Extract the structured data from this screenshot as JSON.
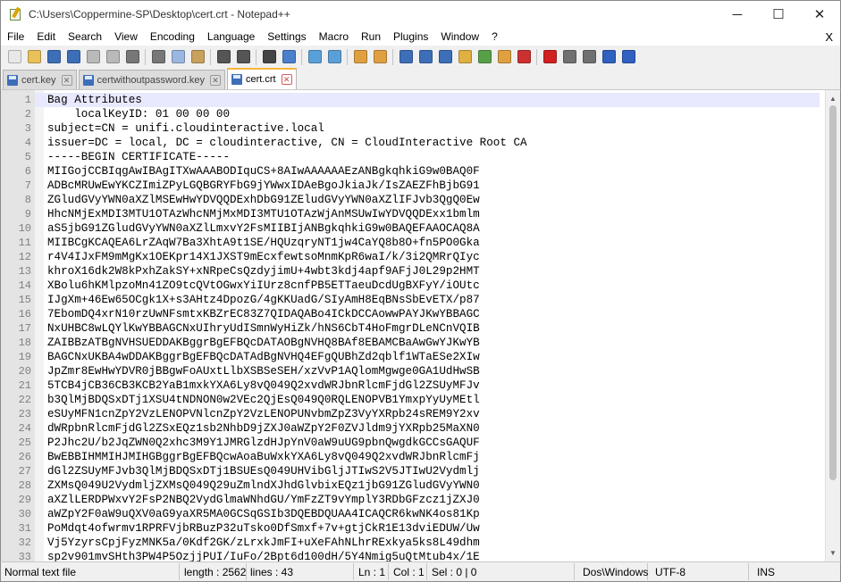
{
  "window": {
    "title": "C:\\Users\\Coppermine-SP\\Desktop\\cert.crt - Notepad++",
    "min": "─",
    "max": "☐",
    "close": "✕"
  },
  "menu": {
    "items": [
      "File",
      "Edit",
      "Search",
      "View",
      "Encoding",
      "Language",
      "Settings",
      "Macro",
      "Run",
      "Plugins",
      "Window",
      "?"
    ],
    "close": "X"
  },
  "toolbar": {
    "buttons": [
      {
        "name": "new-file-icon",
        "color": "#e8e8e8"
      },
      {
        "name": "open-file-icon",
        "color": "#e8c15a"
      },
      {
        "name": "save-icon",
        "color": "#3d6fb8"
      },
      {
        "name": "save-all-icon",
        "color": "#3d6fb8"
      },
      {
        "name": "close-icon",
        "color": "#b9b9b9"
      },
      {
        "name": "close-all-icon",
        "color": "#b9b9b9"
      },
      {
        "name": "print-icon",
        "color": "#777777"
      },
      {
        "sep": true
      },
      {
        "name": "cut-icon",
        "color": "#777777"
      },
      {
        "name": "copy-icon",
        "color": "#9bb7df"
      },
      {
        "name": "paste-icon",
        "color": "#c9a15e"
      },
      {
        "sep": true
      },
      {
        "name": "undo-icon",
        "color": "#555555"
      },
      {
        "name": "redo-icon",
        "color": "#555555"
      },
      {
        "sep": true
      },
      {
        "name": "find-icon",
        "color": "#444444"
      },
      {
        "name": "replace-icon",
        "color": "#4a7fcb"
      },
      {
        "sep": true
      },
      {
        "name": "zoom-in-icon",
        "color": "#5aa0d8"
      },
      {
        "name": "zoom-out-icon",
        "color": "#5aa0d8"
      },
      {
        "sep": true
      },
      {
        "name": "sync-vertical-icon",
        "color": "#e0a040"
      },
      {
        "name": "sync-horizontal-icon",
        "color": "#e0a040"
      },
      {
        "sep": true
      },
      {
        "name": "word-wrap-icon",
        "color": "#3d6fb8"
      },
      {
        "name": "show-all-chars-icon",
        "color": "#3d6fb8"
      },
      {
        "name": "indent-guide-icon",
        "color": "#3d6fb8"
      },
      {
        "name": "user-language-icon",
        "color": "#e0b040"
      },
      {
        "name": "document-map-icon",
        "color": "#58a048"
      },
      {
        "name": "function-list-icon",
        "color": "#e0a040"
      },
      {
        "name": "folder-as-workspace-icon",
        "color": "#cc3030"
      },
      {
        "sep": true
      },
      {
        "name": "record-macro-icon",
        "color": "#d02020"
      },
      {
        "name": "stop-recording-icon",
        "color": "#707070"
      },
      {
        "name": "playback-macro-icon",
        "color": "#707070"
      },
      {
        "name": "run-macro-multiple-icon",
        "color": "#3060c0"
      },
      {
        "name": "save-macro-icon",
        "color": "#3060c0"
      }
    ]
  },
  "tabs": [
    {
      "label": "cert.key",
      "active": false
    },
    {
      "label": "certwithoutpassword.key",
      "active": false
    },
    {
      "label": "cert.crt",
      "active": true
    }
  ],
  "editor": {
    "lines": [
      "Bag Attributes",
      "    localKeyID: 01 00 00 00",
      "subject=CN = unifi.cloudinteractive.local",
      "issuer=DC = local, DC = cloudinteractive, CN = CloudInteractive Root CA",
      "-----BEGIN CERTIFICATE-----",
      "MIIGojCCBIqgAwIBAgITXwAAABODIquCS+8AIwAAAAAAEzANBgkqhkiG9w0BAQ0F",
      "ADBcMRUwEwYKCZImiZPyLGQBGRYFbG9jYWwxIDAeBgoJkiaJk/IsZAEZFhBjbG91",
      "ZGludGVyYWN0aXZlMSEwHwYDVQQDExhDbG91ZEludGVyYWN0aXZlIFJvb3QgQ0Ew",
      "HhcNMjExMDI3MTU1OTAzWhcNMjMxMDI3MTU1OTAzWjAnMSUwIwYDVQQDExx1bmlm",
      "aS5jbG91ZGludGVyYWN0aXZlLmxvY2FsMIIBIjANBgkqhkiG9w0BAQEFAAOCAQ8A",
      "MIIBCgKCAQEA6LrZAqW7Ba3XhtA9t1SE/HQUzqryNT1jw4CaYQ8b8O+fn5PO0Gka",
      "r4V4IJxFM9mMgKx1OEKpr14X1JXST9mEcxfewtsoMnmKpR6waI/k/3i2QMRrQIyc",
      "khroX16dk2W8kPxhZakSY+xNRpeCsQzdyjimU+4wbt3kdj4apf9AFjJ0L29p2HMT",
      "XBolu6hKMlpzoMn41ZO9tcQVtOGwxYiIUrz8cnfPB5ETTaeuDcdUgBXFyY/iOUtc",
      "IJgXm+46Ew65OCgk1X+s3AHtz4DpozG/4gKKUadG/SIyAmH8EqBNsSbEvETX/p87",
      "7EbomDQ4xrN10rzUwNFsmtxKBZrEC83Z7QIDAQABo4ICkDCCAowwPAYJKwYBBAGC",
      "NxUHBC8wLQYlKwYBBAGCNxUIhryUdISmnWyHiZk/hNS6CbT4HoFmgrDLeNCnVQIB",
      "ZAIBBzATBgNVHSUEDDAKBggrBgEFBQcDATAOBgNVHQ8BAf8EBAMCBaAwGwYJKwYB",
      "BAGCNxUKBA4wDDAKBggrBgEFBQcDATAdBgNVHQ4EFgQUBhZd2qblf1WTaESe2XIw",
      "JpZmr8EwHwYDVR0jBBgwFoAUxtLlbXSBSeSEH/xzVvP1AQlomMgwge0GA1UdHwSB",
      "5TCB4jCB36CB3KCB2YaB1mxkYXA6Ly8vQ049Q2xvdWRJbnRlcmFjdGl2ZSUyMFJv",
      "b3QlMjBDQSxDTj1XSU4tNDNON0w2VEc2QjEsQ049Q0RQLENOPVB1YmxpYyUyMEtl",
      "eSUyMFN1cnZpY2VzLENOPVNlcnZpY2VzLENOPUNvbmZpZ3VyYXRpb24sREM9Y2xv",
      "dWRpbnRlcmFjdGl2ZSxEQz1sb2NhbD9jZXJ0aWZpY2F0ZVJldm9jYXRpb25MaXN0",
      "P2Jhc2U/b2JqZWN0Q2xhc3M9Y1JMRGlzdHJpYnV0aW9uUG9pbnQwgdkGCCsGAQUF",
      "BwEBBIHMMIHJMIHGBggrBgEFBQcwAoaBuWxkYXA6Ly8vQ049Q2xvdWRJbnRlcmFj",
      "dGl2ZSUyMFJvb3QlMjBDQSxDTj1BSUEsQ049UHVibGljJTIwS2V5JTIwU2Vydmlj",
      "ZXMsQ049U2VydmljZXMsQ049Q29uZmlndXJhdGlvbixEQz1jbG91ZGludGVyYWN0",
      "aXZlLERDPWxvY2FsP2NBQ2VydGlmaWNhdGU/YmFzZT9vYmplY3RDbGFzcz1jZXJ0",
      "aWZpY2F0aW9uQXV0aG9yaXR5MA0GCSqGSIb3DQEBDQUAA4ICAQCR6kwNK4os81Kp",
      "PoMdqt4ofwrmv1RPRFVjbRBuzP32uTsko0DfSmxf+7v+gtjCkR1E13dviEDUW/Uw",
      "Vj5YzyrsCpjFyzMNK5a/0Kdf2GK/zLrxkJmFI+uXeFAhNLhrRExkya5ks8L49dhm",
      "sp2v901mvSHth3PW4P5OzjjPUI/IuFo/2Bpt6d100dH/5Y4Nmig5uQtMtub4x/1E"
    ]
  },
  "status": {
    "file_type": "Normal text file",
    "length": "length : 2562",
    "lines": "lines : 43",
    "ln": "Ln : 1",
    "col": "Col : 1",
    "sel": "Sel : 0 | 0",
    "eol": "Dos\\Windows",
    "encoding": "UTF-8",
    "mode": "INS"
  }
}
